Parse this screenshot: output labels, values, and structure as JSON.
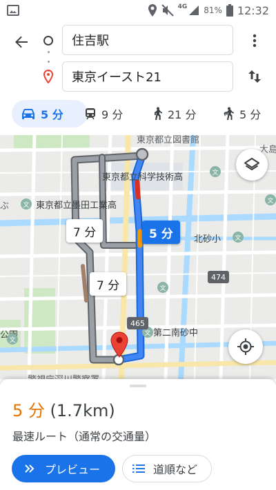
{
  "status_bar": {
    "icons": [
      "image-icon",
      "location-icon",
      "mute-icon",
      "signal-icon",
      "battery-icon"
    ],
    "network": "4G",
    "battery": "81%",
    "time": "12:32"
  },
  "route": {
    "origin": "住吉駅",
    "destination": "東京イースト21"
  },
  "modes": [
    {
      "name": "car",
      "label": "5 分"
    },
    {
      "name": "transit",
      "label": "9 分"
    },
    {
      "name": "walk",
      "label": "21 分"
    },
    {
      "name": "cycle",
      "label": "5 分"
    }
  ],
  "map": {
    "labels": {
      "science_high": "東京都立科学技術高",
      "sumida_high": "東京都立墨田工業高",
      "kitasuna": "北砂小",
      "minamisuna": "第二南砂中",
      "top_right": "大島",
      "top_center": "東京都立図書館",
      "left_park": "公園",
      "left_edge": "ぶ",
      "bottom_left": "警視庁深川警察署"
    },
    "route_badges": [
      "474",
      "465"
    ],
    "bubbles": {
      "main": "5 分",
      "alt1": "7 分",
      "alt2": "7 分"
    },
    "poi_icon": "文"
  },
  "summary": {
    "duration": "5 分",
    "distance": "(1.7km)",
    "description": "最速ルート（通常の交通量）",
    "preview_label": "プレビュー",
    "steps_label": "道順など"
  },
  "colors": {
    "accent": "#1a73e8",
    "duration": "#e37400",
    "route_main": "#4285f4",
    "route_alt": "#9aa0a6",
    "traffic_red": "#d93025",
    "traffic_orange": "#f29900",
    "pin": "#ea4335"
  }
}
